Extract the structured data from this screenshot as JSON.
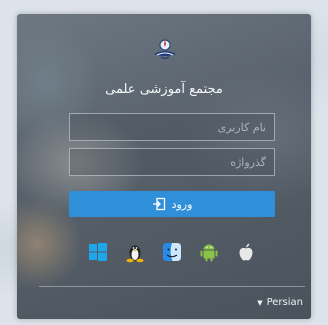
{
  "login": {
    "title": "مجتمع آموزشی علمی",
    "username_placeholder": "نام کاربری",
    "password_placeholder": "گذرواژه",
    "submit_label": "ورود",
    "platform_icons": [
      "windows-icon",
      "linux-icon",
      "mac-finder-icon",
      "android-icon",
      "apple-icon"
    ],
    "language": "Persian",
    "accent_color": "#2f8fd8"
  }
}
